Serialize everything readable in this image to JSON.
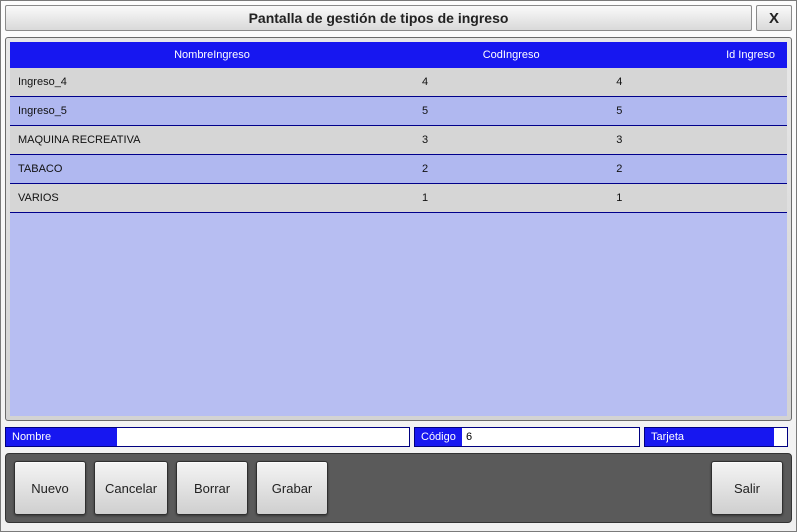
{
  "window": {
    "title": "Pantalla de gestión de tipos de ingreso",
    "close": "X"
  },
  "table": {
    "headers": {
      "nombre": "NombreIngreso",
      "cod": "CodIngreso",
      "id": "Id Ingreso"
    },
    "rows": [
      {
        "nombre": "Ingreso_4",
        "cod": "4",
        "id": "4"
      },
      {
        "nombre": "Ingreso_5",
        "cod": "5",
        "id": "5"
      },
      {
        "nombre": "MAQUINA RECREATIVA",
        "cod": "3",
        "id": "3"
      },
      {
        "nombre": "TABACO",
        "cod": "2",
        "id": "2"
      },
      {
        "nombre": "VARIOS",
        "cod": "1",
        "id": "1"
      }
    ]
  },
  "form": {
    "nombre_label": "Nombre",
    "nombre_value": "",
    "codigo_label": "Código",
    "codigo_value": "6",
    "tarjeta_label": "Tarjeta",
    "tarjeta_value": ""
  },
  "buttons": {
    "nuevo": "Nuevo",
    "cancelar": "Cancelar",
    "borrar": "Borrar",
    "grabar": "Grabar",
    "salir": "Salir"
  }
}
